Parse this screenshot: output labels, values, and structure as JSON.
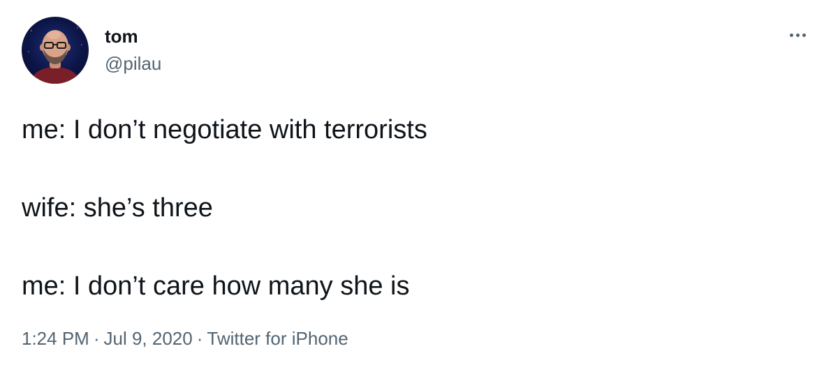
{
  "author": {
    "display_name": "tom",
    "handle": "@pilau"
  },
  "tweet": {
    "lines": [
      "me: I don’t negotiate with terrorists",
      "wife: she’s three",
      "me: I don’t care how many she is"
    ],
    "time": "1:24 PM",
    "date": "Jul 9, 2020",
    "separator": "·",
    "source": "Twitter for iPhone"
  },
  "icons": {
    "more": "more-horizontal-icon",
    "avatar": "profile-photo"
  },
  "colors": {
    "text_primary": "#0f1419",
    "text_secondary": "#536471",
    "background": "#ffffff"
  }
}
